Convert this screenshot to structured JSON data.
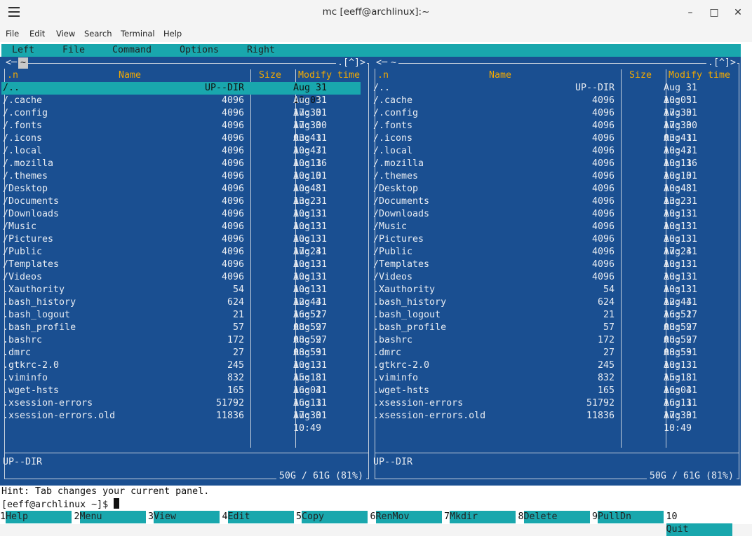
{
  "window": {
    "title": "mc [eeff@archlinux]:~",
    "minimize": "–",
    "maximize": "□",
    "close": "✕"
  },
  "appmenu": [
    "File",
    "Edit",
    "View",
    "Search",
    "Terminal",
    "Help"
  ],
  "mc_menu": [
    "Left",
    "File",
    "Command",
    "Options",
    "Right"
  ],
  "panels": {
    "left": {
      "path": "~",
      "corner_left": "<─",
      "corner_right": ".[^]>",
      "status": "UP--DIR",
      "disk": "50G / 61G (81%)",
      "selected_index": 0
    },
    "right": {
      "path": "~",
      "corner_left": "<─",
      "corner_right": ".[^]>",
      "status": "UP--DIR",
      "disk": "50G / 61G (81%)",
      "selected_index": -1
    }
  },
  "columns": {
    "sort": ".n",
    "name": "Name",
    "size": "Size",
    "time": "Modify time"
  },
  "files": [
    {
      "name": "/..",
      "size": "UP--DIR",
      "time": "Aug 31 10:05"
    },
    {
      "name": "/.cache",
      "size": "4096",
      "time": "Aug 31 17:30"
    },
    {
      "name": "/.config",
      "size": "4096",
      "time": "Aug 31 17:30"
    },
    {
      "name": "/.fonts",
      "size": "4096",
      "time": "Aug 30 03:41"
    },
    {
      "name": "/.icons",
      "size": "4096",
      "time": "Aug 31 10:47"
    },
    {
      "name": "/.local",
      "size": "4096",
      "time": "Aug 31 10:13"
    },
    {
      "name": "/.mozilla",
      "size": "4096",
      "time": "Aug 16 10:10"
    },
    {
      "name": "/.themes",
      "size": "4096",
      "time": "Aug 31 10:48"
    },
    {
      "name": "/Desktop",
      "size": "4096",
      "time": "Aug 31 13:23"
    },
    {
      "name": "/Documents",
      "size": "4096",
      "time": "Aug 31 10:13"
    },
    {
      "name": "/Downloads",
      "size": "4096",
      "time": "Aug 31 10:13"
    },
    {
      "name": "/Music",
      "size": "4096",
      "time": "Aug 31 10:13"
    },
    {
      "name": "/Pictures",
      "size": "4096",
      "time": "Aug 31 17:24"
    },
    {
      "name": "/Public",
      "size": "4096",
      "time": "Aug 31 10:13"
    },
    {
      "name": "/Templates",
      "size": "4096",
      "time": "Aug 31 10:13"
    },
    {
      "name": "/Videos",
      "size": "4096",
      "time": "Aug 31 10:13"
    },
    {
      "name": " .Xauthority",
      "size": "54",
      "time": "Aug 31 12:44"
    },
    {
      "name": " .bash_history",
      "size": "624",
      "time": "Aug 31 16:51"
    },
    {
      "name": " .bash_logout",
      "size": "21",
      "time": "Aug 27 08:59"
    },
    {
      "name": " .bash_profile",
      "size": "57",
      "time": "Aug 27 08:59"
    },
    {
      "name": " .bashrc",
      "size": "172",
      "time": "Aug 27 08:59"
    },
    {
      "name": " .dmrc",
      "size": "27",
      "time": "Aug 31 10:13"
    },
    {
      "name": " .gtkrc-2.0",
      "size": "245",
      "time": "Aug 31 15:18"
    },
    {
      "name": " .viminfo",
      "size": "832",
      "time": "Aug 31 16:04"
    },
    {
      "name": " .wget-hsts",
      "size": "165",
      "time": "Aug 31 16:11"
    },
    {
      "name": " .xsession-errors",
      "size": "51792",
      "time": "Aug 31 17:30"
    },
    {
      "name": " .xsession-errors.old",
      "size": "11836",
      "time": "Aug 31 10:49"
    }
  ],
  "hint": "Hint: Tab changes your current panel.",
  "prompt": "[eeff@archlinux ~]$ ",
  "fkeys": [
    {
      "num": "1",
      "label": "Help"
    },
    {
      "num": "2",
      "label": "Menu"
    },
    {
      "num": "3",
      "label": "View"
    },
    {
      "num": "4",
      "label": "Edit"
    },
    {
      "num": "5",
      "label": "Copy"
    },
    {
      "num": "6",
      "label": "RenMov"
    },
    {
      "num": "7",
      "label": "Mkdir"
    },
    {
      "num": "8",
      "label": "Delete"
    },
    {
      "num": "9",
      "label": "PullDn"
    },
    {
      "num": "10",
      "label": "Quit"
    }
  ],
  "colors": {
    "panel_bg": "#1a4f91",
    "accent_cyan": "#19a7ad",
    "header_yellow": "#f2a900"
  }
}
